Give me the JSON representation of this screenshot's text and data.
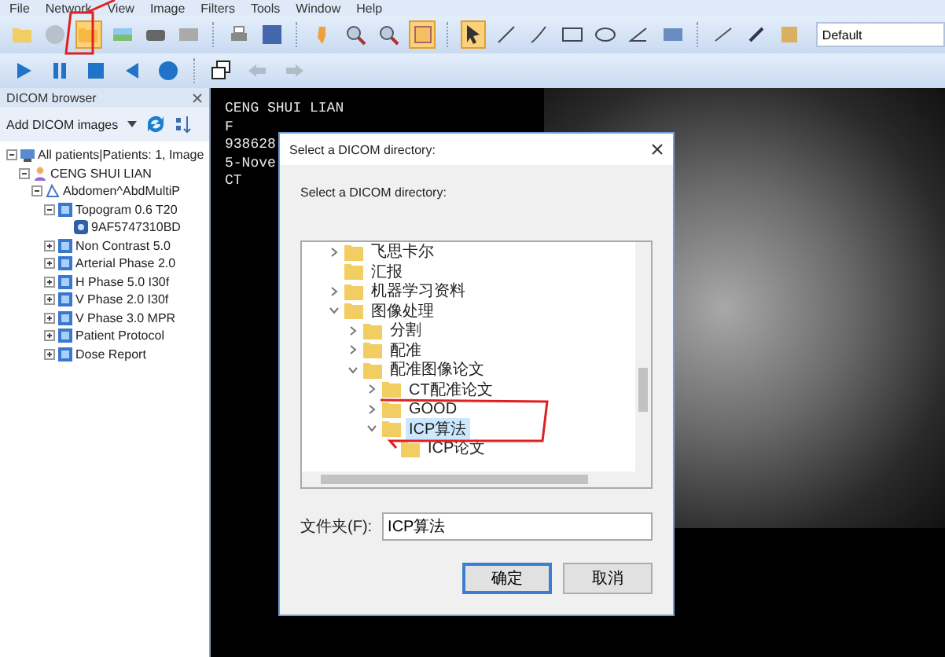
{
  "menu": [
    "File",
    "Network",
    "View",
    "Image",
    "Filters",
    "Tools",
    "Window",
    "Help"
  ],
  "preset_select": {
    "value": "Default"
  },
  "browser": {
    "title": "DICOM browser",
    "add_button": "Add DICOM images",
    "tree": [
      {
        "label": "All patients|Patients: 1, Image",
        "kind": "root",
        "expanded": true,
        "children": [
          {
            "label": "CENG SHUI LIAN",
            "kind": "patient",
            "expanded": true,
            "children": [
              {
                "label": "Abdomen^AbdMultiP",
                "kind": "study",
                "expanded": true,
                "children": [
                  {
                    "label": "Topogram  0.6  T20",
                    "kind": "series",
                    "expanded": true,
                    "children": [
                      {
                        "label": "9AF5747310BD",
                        "kind": "image"
                      }
                    ]
                  },
                  {
                    "label": "Non Contrast  5.0",
                    "kind": "series",
                    "expanded": false
                  },
                  {
                    "label": "Arterial Phase  2.0",
                    "kind": "series",
                    "expanded": false
                  },
                  {
                    "label": "H Phase  5.0  I30f",
                    "kind": "series",
                    "expanded": false
                  },
                  {
                    "label": "V Phase  2.0  I30f",
                    "kind": "series",
                    "expanded": false
                  },
                  {
                    "label": "V Phase  3.0  MPR",
                    "kind": "series",
                    "expanded": false
                  },
                  {
                    "label": "Patient Protocol",
                    "kind": "series",
                    "expanded": false
                  },
                  {
                    "label": "Dose Report",
                    "kind": "series",
                    "expanded": false
                  }
                ]
              }
            ]
          }
        ]
      }
    ]
  },
  "overlay_text": [
    "CENG SHUI LIAN",
    "F",
    "938628",
    "5-Nove",
    "CT"
  ],
  "dialog": {
    "title": "Select a DICOM directory:",
    "prompt": "Select a DICOM directory:",
    "folders": [
      {
        "label": "飞思卡尔",
        "expanded": false,
        "selected": false
      },
      {
        "label": "汇报",
        "selected": false
      },
      {
        "label": "机器学习资料",
        "expanded": false,
        "selected": false
      },
      {
        "label": "图像处理",
        "expanded": true,
        "selected": false,
        "children": [
          {
            "label": "分割",
            "expanded": false,
            "selected": false
          },
          {
            "label": "配准",
            "expanded": false,
            "selected": false
          },
          {
            "label": "配准图像论文",
            "expanded": true,
            "selected": false,
            "children": [
              {
                "label": "CT配准论文",
                "expanded": false,
                "selected": false
              },
              {
                "label": "GOOD",
                "expanded": false,
                "selected": false
              },
              {
                "label": "ICP算法",
                "expanded": true,
                "selected": true,
                "children": [
                  {
                    "label": "ICP论文",
                    "selected": false
                  }
                ]
              }
            ]
          }
        ]
      }
    ],
    "folder_label": "文件夹(F):",
    "folder_value": "ICP算法",
    "buttons": [
      {
        "label": "确定",
        "kind": "primary"
      },
      {
        "label": "取消",
        "kind": "secondary"
      }
    ]
  }
}
